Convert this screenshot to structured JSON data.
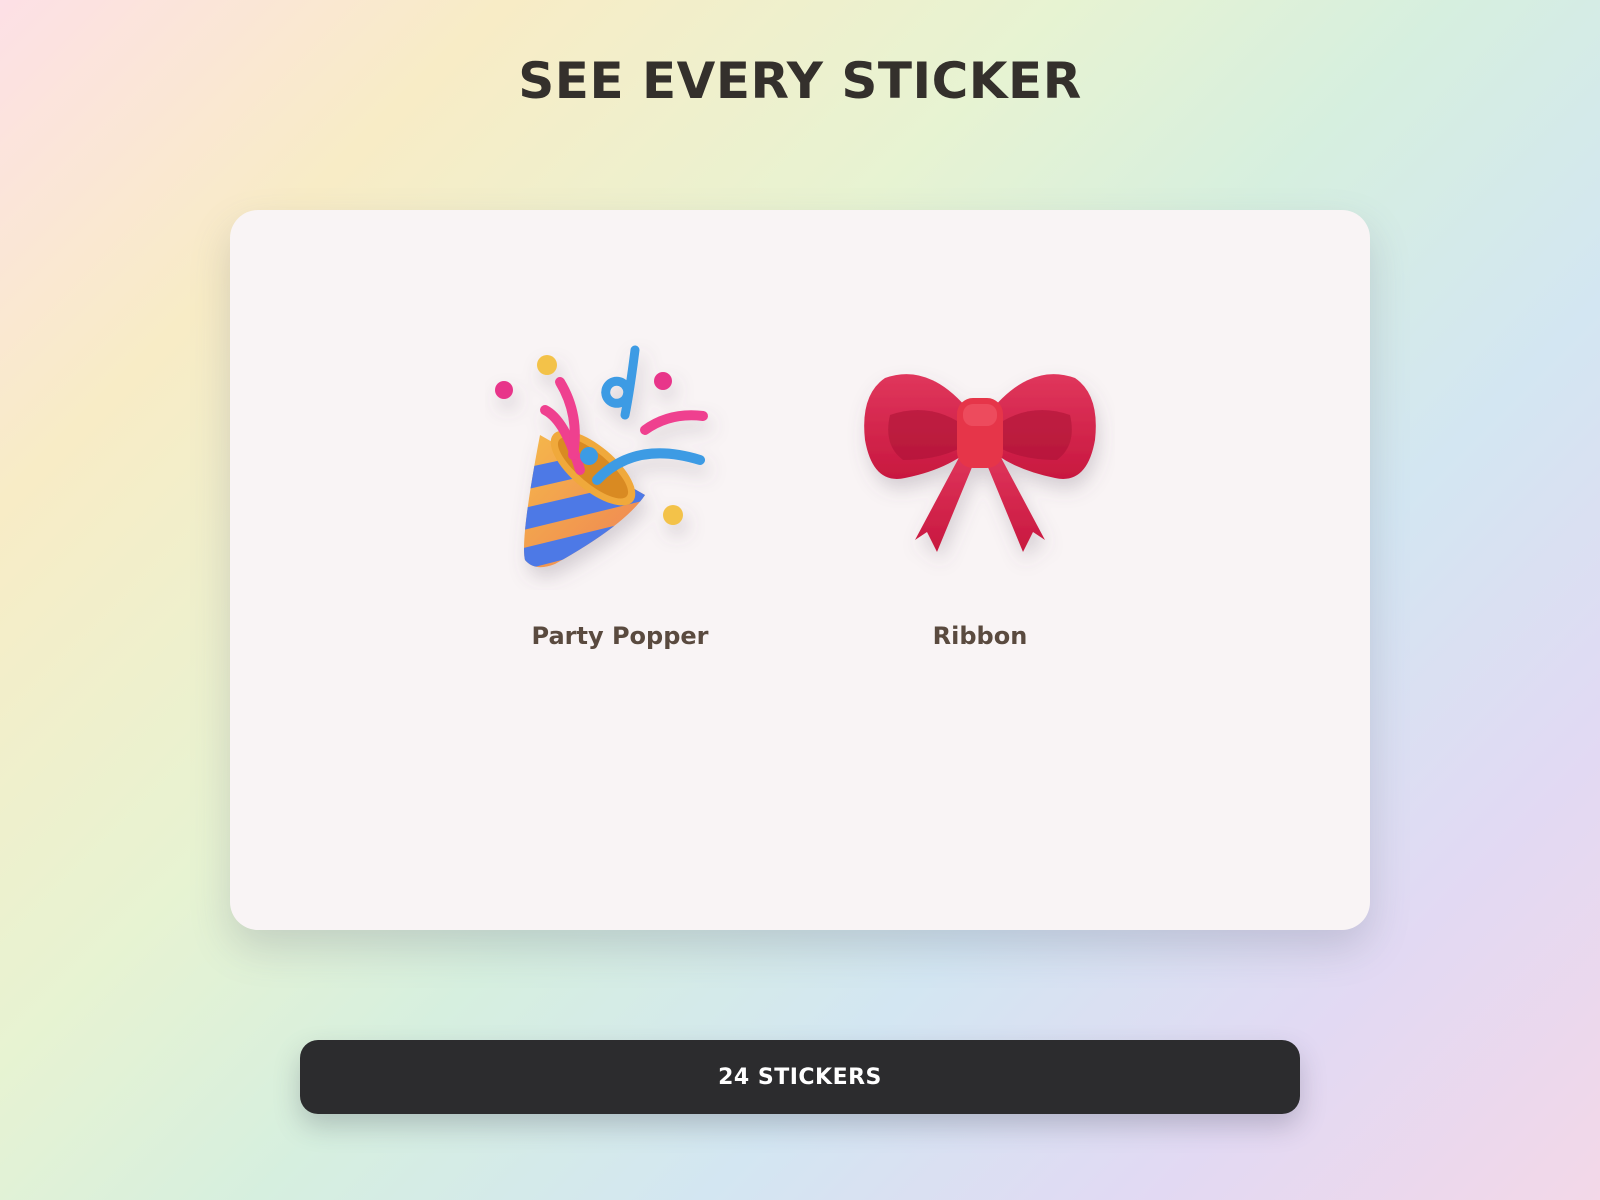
{
  "header": {
    "title": "SEE EVERY STICKER"
  },
  "stickers": [
    {
      "name": "Party Popper",
      "icon": "party-popper-icon"
    },
    {
      "name": "Ribbon",
      "icon": "ribbon-bow-icon"
    }
  ],
  "footer": {
    "count_label": "24 STICKERS"
  },
  "colors": {
    "title": "#34302c",
    "panel": "#f9f4f5",
    "label": "#5a4a3f",
    "bar": "#2c2c2e",
    "bar_text": "#ffffff"
  }
}
